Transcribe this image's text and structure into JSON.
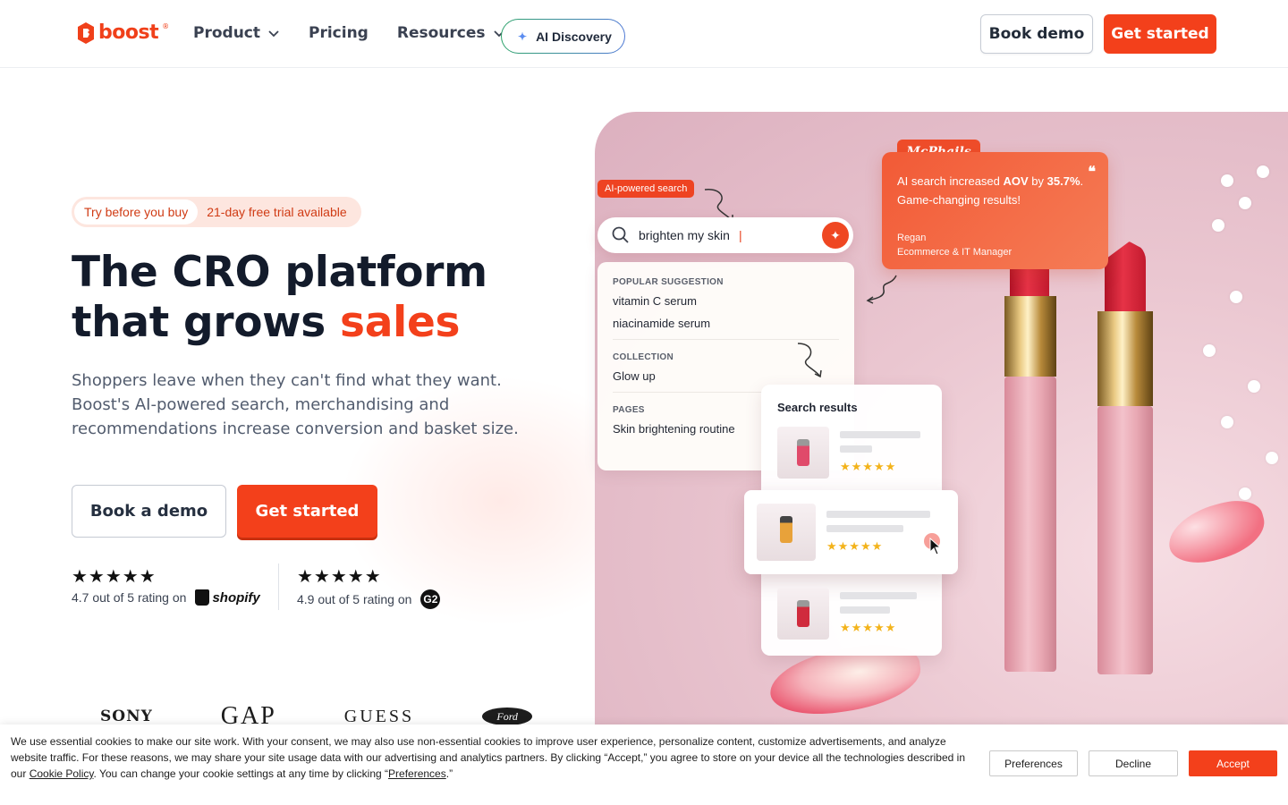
{
  "header": {
    "logo_text": "boost",
    "logo_mark": "®",
    "nav": [
      {
        "label": "Product",
        "has_chevron": true
      },
      {
        "label": "Pricing",
        "has_chevron": false
      },
      {
        "label": "Resources",
        "has_chevron": true
      }
    ],
    "ai_discovery_label": "AI Discovery",
    "book_demo_label": "Book demo",
    "get_started_label": "Get started"
  },
  "hero": {
    "trial_pill_inner": "Try before you buy",
    "trial_pill_outer": "21-day free trial available",
    "headline_line1": "The CRO platform",
    "headline_line2_prefix": "that grows ",
    "headline_line2_accent": "sales",
    "subtext": "Shoppers leave when they can't find what they want. Boost's AI-powered search, merchandising and recommendations increase conversion and basket size.",
    "book_a_demo_label": "Book a demo",
    "get_started_label": "Get started",
    "ratings": [
      {
        "stars": "★★★★★",
        "text": "4.7 out of 5 rating on",
        "platform": "shopify"
      },
      {
        "stars": "★★★★★",
        "text": "4.9 out of 5 rating on",
        "platform": "G2"
      }
    ],
    "brands": [
      "SONY",
      "GAP",
      "GUESS",
      "Ford"
    ]
  },
  "visual": {
    "ai_tag": "AI-powered search",
    "search_query": "brighten my skin",
    "suggestions": {
      "popular_heading": "POPULAR SUGGESTION",
      "popular_items": [
        "vitamin C serum",
        "niacinamide serum"
      ],
      "collection_heading": "COLLECTION",
      "collection_items": [
        "Glow up"
      ],
      "pages_heading": "PAGES",
      "pages_items": [
        "Skin brightening routine"
      ]
    },
    "review": {
      "brand": "McPhails",
      "quote_mark": "❝",
      "text_prefix": "AI search increased ",
      "text_strong1": "AOV",
      "text_mid": " by ",
      "text_strong2": "35.7%",
      "text_suffix": ".",
      "text_line2": "Game-changing results!",
      "author_name": "Regan",
      "author_title": "Ecommerce & IT Manager"
    },
    "results_heading": "Search results",
    "result_stars": "★★★★★"
  },
  "cookie": {
    "text_part1": "We use essential cookies to make our site work. With your consent, we may also use non-essential cookies to improve user experience, personalize content, customize advertisements, and analyze website traffic. For these reasons, we may share your site usage data with our advertising and analytics partners. By clicking “Accept,” you agree to store on your device all the technologies described in our ",
    "cookie_policy_link": "Cookie Policy",
    "text_part2": ". You can change your cookie settings at any time by clicking “",
    "preferences_link": "Preferences",
    "text_part3": ".”",
    "preferences_label": "Preferences",
    "decline_label": "Decline",
    "accept_label": "Accept"
  },
  "colors": {
    "brand_orange": "#f3401b",
    "text_dark": "#131b2b",
    "text_muted": "#525c6e"
  }
}
